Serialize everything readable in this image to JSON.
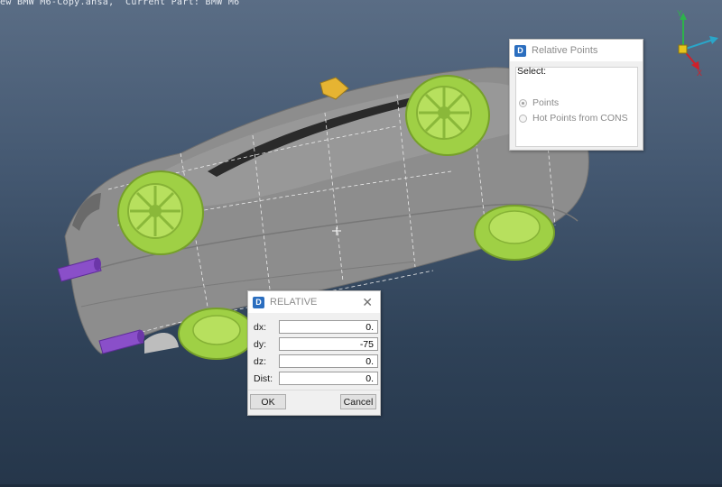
{
  "status_bar": {
    "text": "ew BMW M6-Copy.ansa,  Current Part: BMW M6"
  },
  "triad": {
    "axis_x": "X",
    "axis_y": "Y",
    "color_x": "#d0202a",
    "color_y": "#2db34a",
    "color_z": "#2aa6c9",
    "color_center": "#e7c51c"
  },
  "model": {
    "body_color": "#8e8e8e",
    "wheel_color": "#a8d64a",
    "exhaust_color": "#8a4fc9",
    "mesh_line_color": "#e8e8e8"
  },
  "relative_points_dialog": {
    "title": "Relative Points",
    "icon": "ansa-app-icon",
    "select_label": "Select:",
    "options": [
      {
        "label": "Points",
        "checked": true
      },
      {
        "label": "Hot Points from CONS",
        "checked": false
      }
    ],
    "close_symbol": "✕"
  },
  "relative_dialog": {
    "title": "RELATIVE",
    "icon": "ansa-app-icon",
    "close_symbol": "✕",
    "fields": [
      {
        "label": "dx:",
        "value": "0."
      },
      {
        "label": "dy:",
        "value": "-75"
      },
      {
        "label": "dz:",
        "value": "0."
      },
      {
        "label": "Dist:",
        "value": "0."
      }
    ],
    "ok_label": "OK",
    "cancel_label": "Cancel"
  }
}
